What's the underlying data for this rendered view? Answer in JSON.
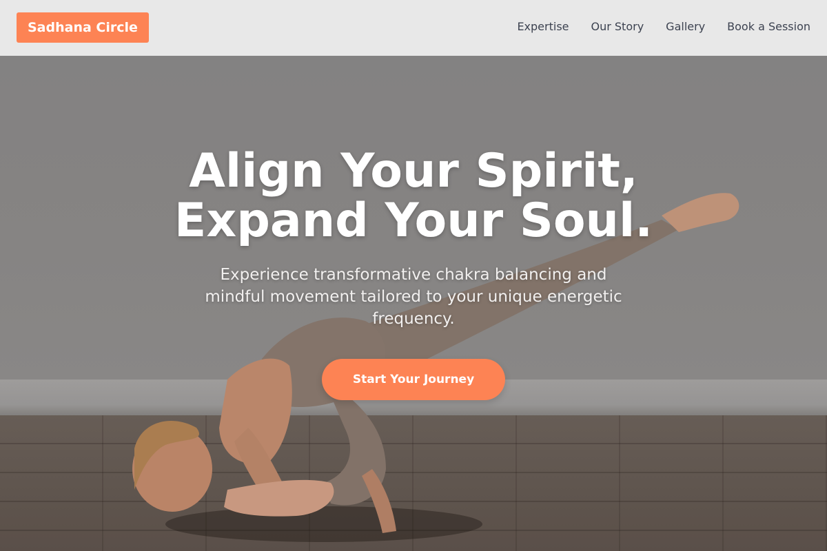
{
  "header": {
    "logo": "Sadhana Circle",
    "nav": [
      "Expertise",
      "Our Story",
      "Gallery",
      "Book a Session"
    ]
  },
  "hero": {
    "headline_line1": "Align Your Spirit,",
    "headline_line2": "Expand Your Soul.",
    "subtext": "Experience transformative chakra balancing and mindful movement tailored to your unique energetic frequency.",
    "cta_label": "Start Your Journey",
    "background_image": "yoga-practitioner-arm-balance-photo"
  },
  "colors": {
    "accent": "#fd8354",
    "header_bg": "#e8e8e8",
    "nav_text": "#3c4250",
    "hero_text": "#ffffff"
  }
}
